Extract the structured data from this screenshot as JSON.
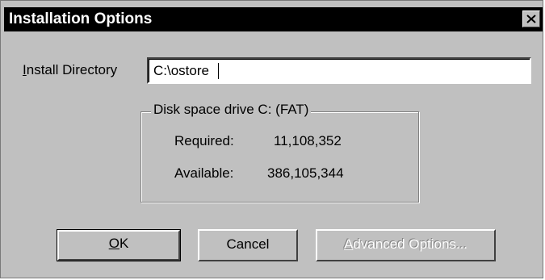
{
  "dialog": {
    "title": "Installation Options",
    "close_icon": "close-x-icon"
  },
  "install": {
    "label_ul": "I",
    "label_rest": "nstall Directory",
    "value": "C:\\ostore"
  },
  "disk": {
    "legend": "Disk space drive C:  (FAT)",
    "required_label": "Required:",
    "required_value": "11,108,352",
    "available_label": "Available:",
    "available_value": "386,105,344"
  },
  "buttons": {
    "ok_ul": "O",
    "ok_rest": "K",
    "cancel": "Cancel",
    "advanced_ul": "A",
    "advanced_rest": "dvanced Options..."
  }
}
